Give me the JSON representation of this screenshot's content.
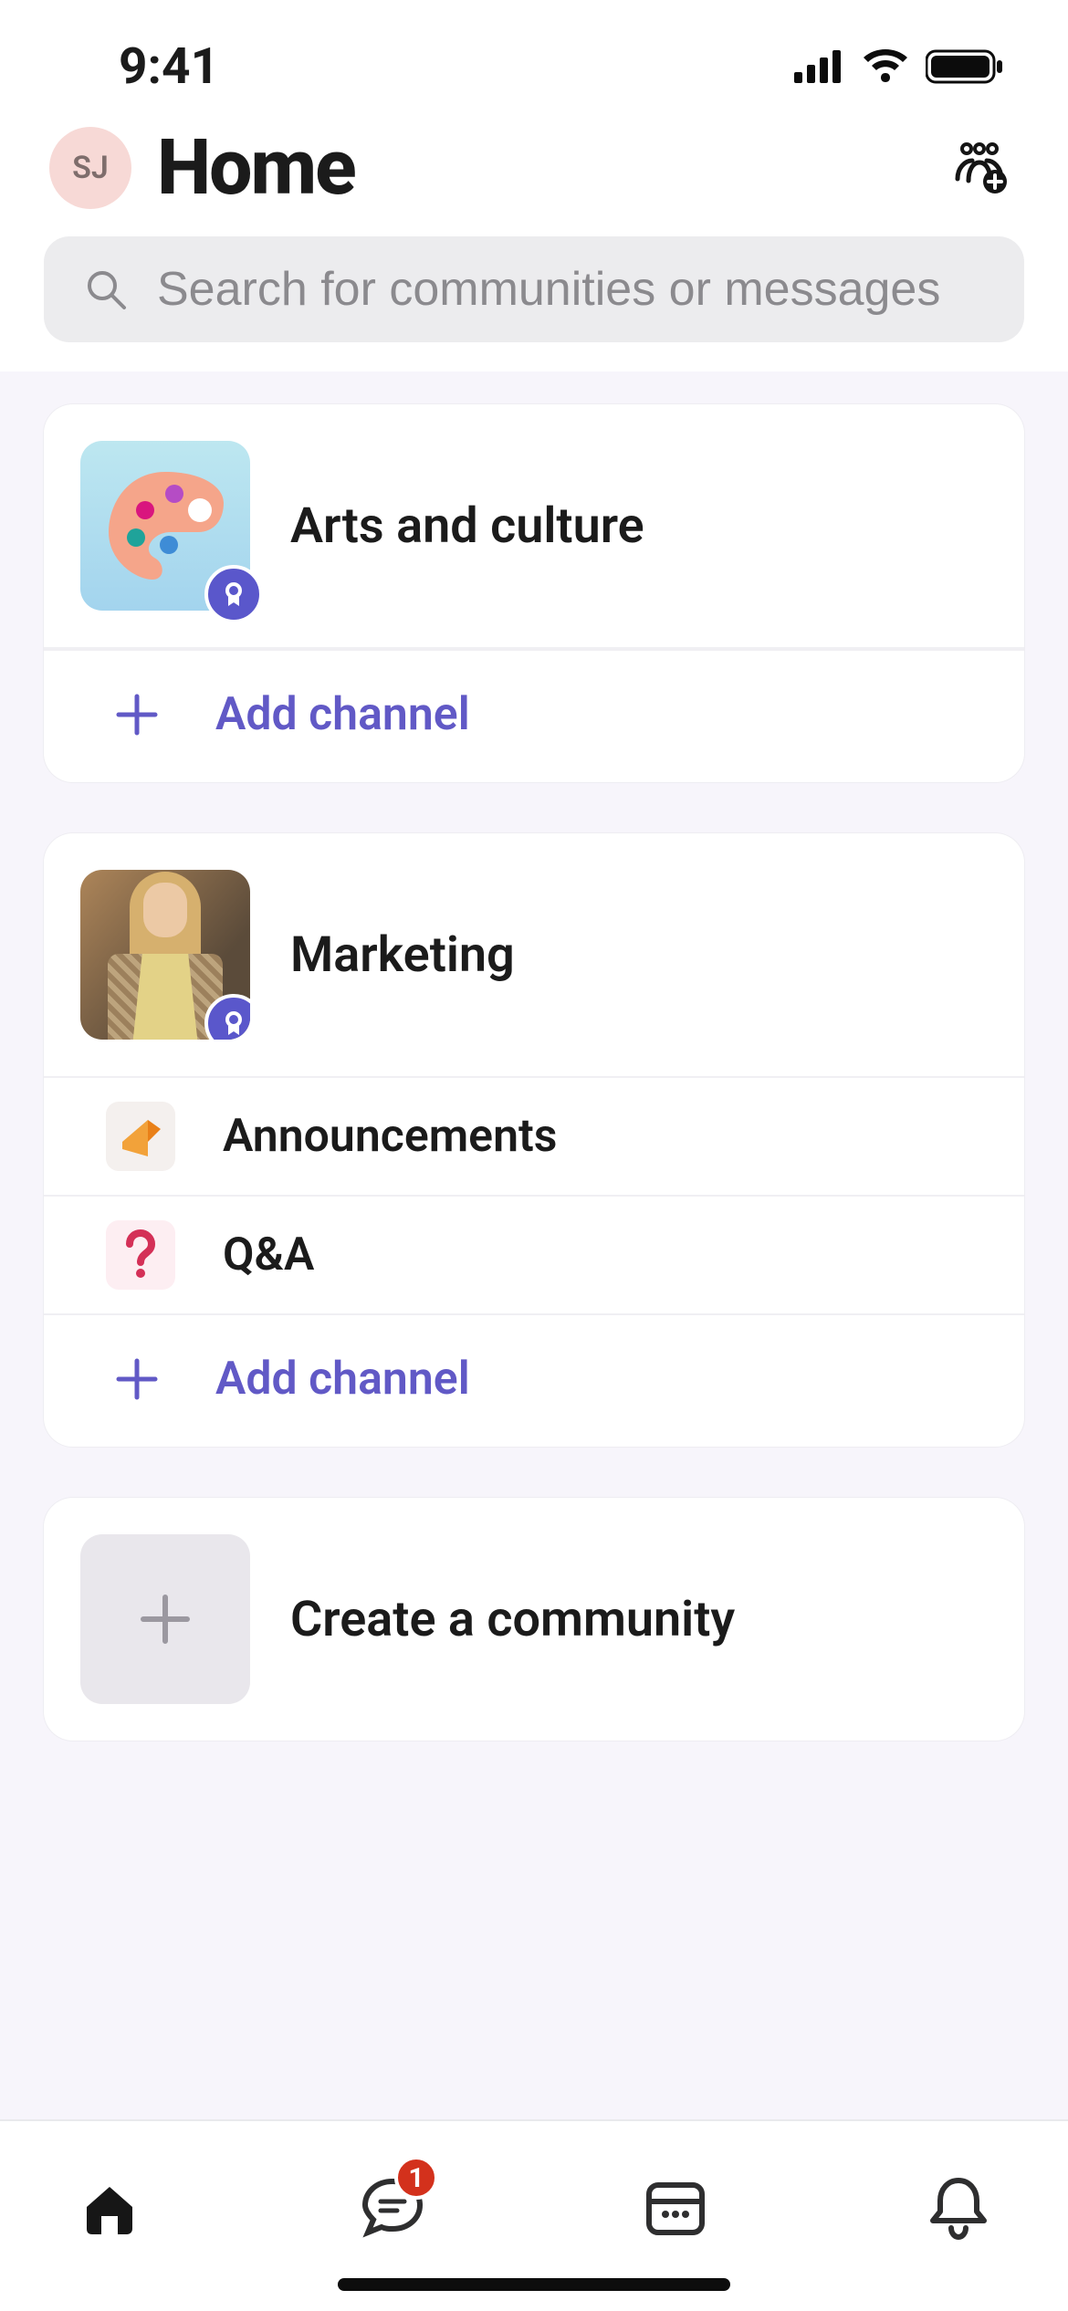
{
  "status": {
    "time": "9:41"
  },
  "header": {
    "avatar_initials": "SJ",
    "title": "Home"
  },
  "search": {
    "placeholder": "Search for communities or messages"
  },
  "communities": [
    {
      "name": "Arts and culture",
      "thumb_kind": "palette",
      "channels": [],
      "add_channel_label": "Add channel"
    },
    {
      "name": "Marketing",
      "thumb_kind": "photo",
      "channels": [
        {
          "name": "Announcements",
          "icon": "megaphone"
        },
        {
          "name": "Q&A",
          "icon": "question"
        }
      ],
      "add_channel_label": "Add channel"
    }
  ],
  "create_label": "Create a community",
  "tabs": {
    "chat_badge": "1"
  }
}
